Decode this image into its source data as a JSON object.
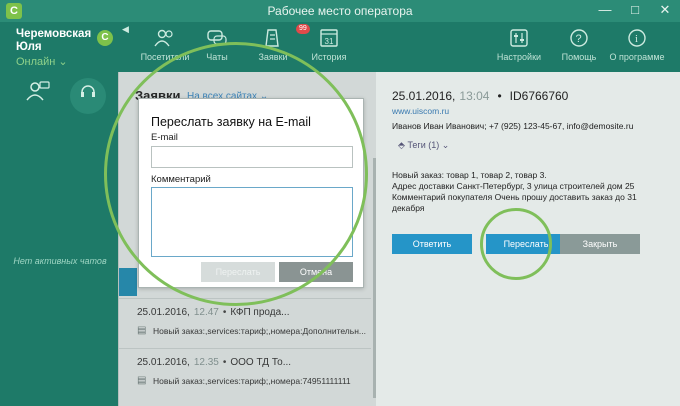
{
  "window": {
    "title": "Рабочее место оператора",
    "app_icon": "С",
    "controls": [
      "—",
      "□",
      "✕"
    ]
  },
  "operator": {
    "name": "Черемовская Юля",
    "status": "Онлайн",
    "badge": "С",
    "no_chats": "Нет активных чатов"
  },
  "nav": {
    "items": [
      {
        "label": "Посетители",
        "icon": "visitors-icon"
      },
      {
        "label": "Чаты",
        "icon": "chats-icon"
      },
      {
        "label": "Заявки",
        "icon": "requests-icon",
        "badge": "99"
      },
      {
        "label": "История",
        "icon": "history-icon",
        "glyph": "31"
      },
      {
        "label": "Настройки",
        "icon": "settings-icon"
      },
      {
        "label": "Помощь",
        "icon": "help-icon"
      },
      {
        "label": "О программе",
        "icon": "about-icon"
      }
    ]
  },
  "list": {
    "header": "Заявки",
    "filter": "На всех сайтах",
    "items": [
      {
        "date": "25.01.2016,",
        "time": "12.47",
        "title": "КФП прода...",
        "text": "Новый заказ:,services:тариф;,номера:Дополнительн..."
      },
      {
        "date": "25.01.2016,",
        "time": "12.35",
        "title": "ООО ТД То...",
        "text": "Новый заказ:,services:тариф;,номера:74951111111"
      }
    ]
  },
  "detail": {
    "date": "25.01.2016,",
    "time": "13:04",
    "id": "ID6766760",
    "site": "www.uiscom.ru",
    "contact": "Иванов Иван Иванович; +7 (925) 123-45-67, info@demosite.ru",
    "tags": "Теги (1)",
    "text_lines": [
      "Новый заказ: товар 1, товар 2, товар 3.",
      "Адрес доставки Санкт-Петербург, 3 улица строителей дом 25",
      "Комментарий покупателя Очень прошу доставить заказ до 31",
      "декабря"
    ],
    "buttons": {
      "reply": "Ответить",
      "forward": "Переслать",
      "close": "Закрыть"
    }
  },
  "modal": {
    "title": "Переслать заявку на E-mail",
    "email_label": "E-mail",
    "email_value": "",
    "comment_label": "Комментарий",
    "comment_value": "",
    "send": "Переслать",
    "cancel": "Отмена"
  },
  "colors": {
    "accent": "#2595c8",
    "highlight_circle": "#7fbf5a",
    "sidebar": "#1e7a68"
  }
}
